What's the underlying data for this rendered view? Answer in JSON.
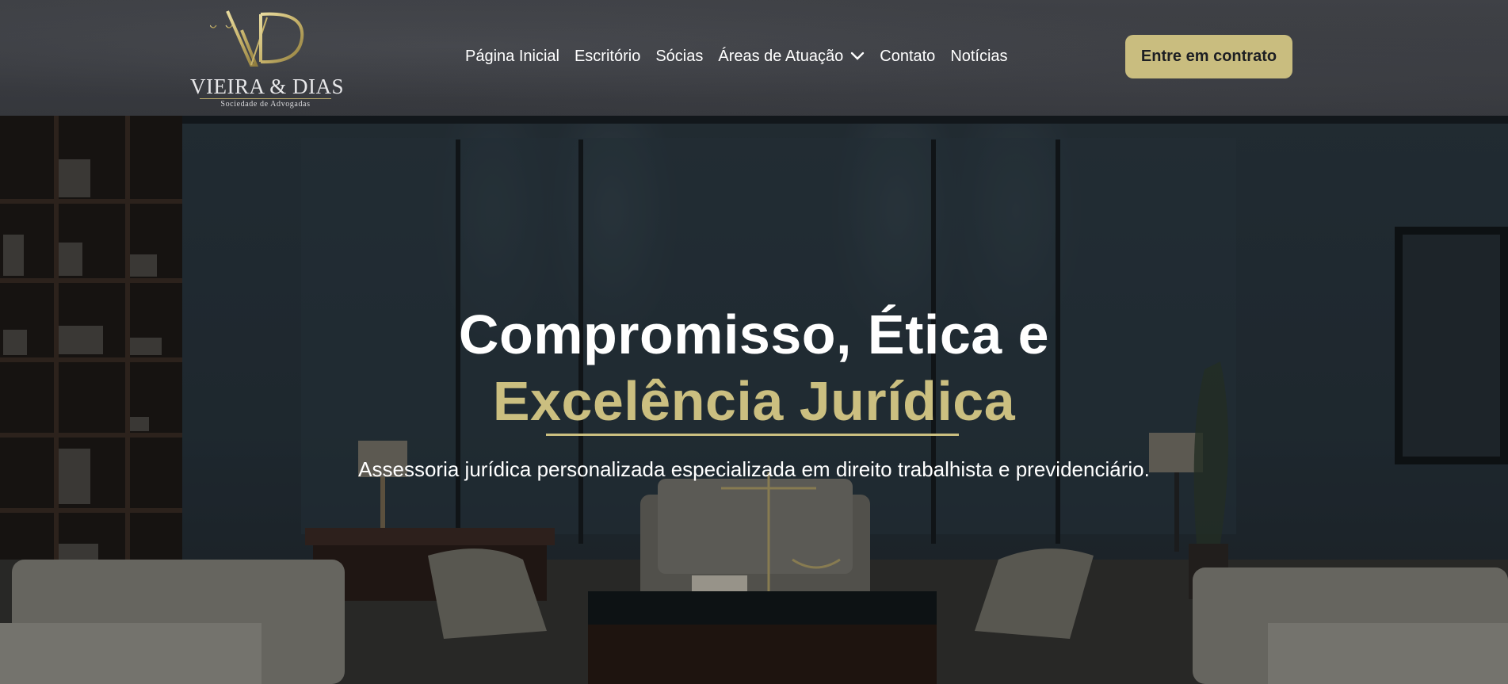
{
  "brand": {
    "name": "VIEIRA & DIAS",
    "tagline": "Sociedade de Advogadas",
    "accent_color": "#c9bd7f"
  },
  "nav": {
    "items": [
      {
        "label": "Página Inicial"
      },
      {
        "label": "Escritório"
      },
      {
        "label": "Sócias"
      },
      {
        "label": "Áreas de Atuação",
        "icon": "chevron-down-icon"
      },
      {
        "label": "Contato"
      },
      {
        "label": "Notícias"
      }
    ]
  },
  "cta": {
    "label": "Entre em contrato"
  },
  "hero": {
    "title_line1": "Compromisso, Ética e",
    "title_line2": "Excelência Jurídica",
    "subtitle": "Assessoria jurídica personalizada especializada em direito trabalhista e previdenciário."
  }
}
